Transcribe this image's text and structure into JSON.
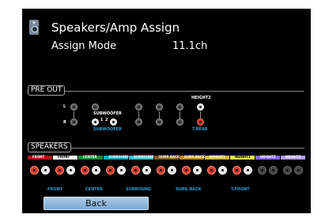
{
  "header": {
    "title": "Speakers/Amp Assign",
    "mode_label": "Assign Mode",
    "mode_value": "11.1ch"
  },
  "pre_out": {
    "label": "PRE OUT",
    "left_tag": "L",
    "right_tag": "R",
    "subwoofer_caption": "SUBWOOFER",
    "sub_1": "1",
    "sub_2": "2",
    "subwoofer_label": "SUBWOOFER",
    "height2_caption": "HEIGHT2",
    "trear_label": "T.REAR"
  },
  "speakers": {
    "label": "SPEAKERS",
    "channels": [
      {
        "name": "FRONT",
        "color": "#b3151b"
      },
      {
        "name": "FRONT",
        "color": "#ffffff"
      },
      {
        "name": "CENTER",
        "color": "#1f8a3a"
      },
      {
        "name": "SURROUND",
        "color": "#1f9fbf"
      },
      {
        "name": "SURROUND",
        "color": "#46b8d8"
      },
      {
        "name": "SURR.BACK",
        "color": "#8a5a1e"
      },
      {
        "name": "SURR.BACK",
        "color": "#c58a2e"
      },
      {
        "name": "HEIGHT1",
        "color": "#d8b34a"
      },
      {
        "name": "HEIGHT1",
        "color": "#e8e25a"
      },
      {
        "name": "HEIGHT2",
        "color": "#8a6ad8"
      },
      {
        "name": "HEIGHT2",
        "color": "#b59ae8"
      }
    ],
    "bottom_labels": {
      "front": "FRONT",
      "center": "CENTER",
      "surround": "SURROUND",
      "surr_back": "SURR.BACK",
      "tfront": "T.FRONT"
    }
  },
  "footer": {
    "back_label": "Back"
  }
}
